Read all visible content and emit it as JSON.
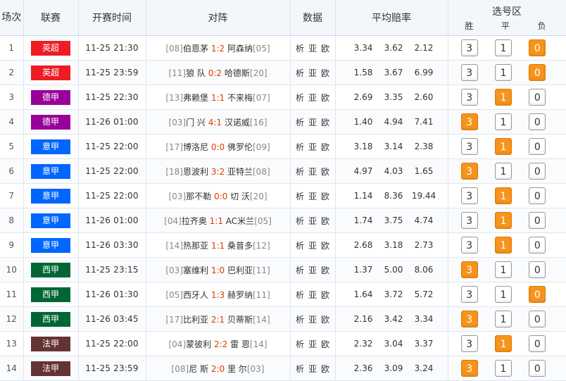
{
  "header": {
    "index": "场次",
    "league": "联赛",
    "time": "开赛时间",
    "match": "对阵",
    "data": "数据",
    "odds": "平均赔率",
    "select": "选号区",
    "win": "胜",
    "draw": "平",
    "lose": "负"
  },
  "colors": {
    "英超": "#ee1c24",
    "德甲": "#990099",
    "意甲": "#0066ff",
    "西甲": "#006633",
    "法甲": "#663333",
    "selected": "#f7941d"
  },
  "data_links": [
    "析",
    "亚",
    "欧"
  ],
  "rows": [
    {
      "no": "1",
      "league": "英超",
      "time": "11-25 21:30",
      "home_rank": "[08]",
      "home": "伯恩茅",
      "score": "1:2",
      "away": "阿森纳",
      "away_rank": "[05]",
      "odds": [
        "3.34",
        "3.62",
        "2.12"
      ],
      "pick": [
        "3",
        "1",
        "0"
      ],
      "selected": 2
    },
    {
      "no": "2",
      "league": "英超",
      "time": "11-25 23:59",
      "home_rank": "[11]",
      "home": "狼 队",
      "score": "0:2",
      "away": "哈德斯",
      "away_rank": "[20]",
      "odds": [
        "1.58",
        "3.67",
        "6.99"
      ],
      "pick": [
        "3",
        "1",
        "0"
      ],
      "selected": 2
    },
    {
      "no": "3",
      "league": "德甲",
      "time": "11-25 22:30",
      "home_rank": "[13]",
      "home": "弗赖堡",
      "score": "1:1",
      "away": "不来梅",
      "away_rank": "[07]",
      "odds": [
        "2.69",
        "3.35",
        "2.60"
      ],
      "pick": [
        "3",
        "1",
        "0"
      ],
      "selected": 1
    },
    {
      "no": "4",
      "league": "德甲",
      "time": "11-26 01:00",
      "home_rank": "[03]",
      "home": "门 兴",
      "score": "4:1",
      "away": "汉诺威",
      "away_rank": "[16]",
      "odds": [
        "1.40",
        "4.94",
        "7.41"
      ],
      "pick": [
        "3",
        "1",
        "0"
      ],
      "selected": 0
    },
    {
      "no": "5",
      "league": "意甲",
      "time": "11-25 22:00",
      "home_rank": "[17]",
      "home": "博洛尼",
      "score": "0:0",
      "away": "佛罗伦",
      "away_rank": "[09]",
      "odds": [
        "3.18",
        "3.14",
        "2.38"
      ],
      "pick": [
        "3",
        "1",
        "0"
      ],
      "selected": 1
    },
    {
      "no": "6",
      "league": "意甲",
      "time": "11-25 22:00",
      "home_rank": "[18]",
      "home": "恩波利",
      "score": "3:2",
      "away": "亚特兰",
      "away_rank": "[08]",
      "odds": [
        "4.97",
        "4.03",
        "1.65"
      ],
      "pick": [
        "3",
        "1",
        "0"
      ],
      "selected": 0
    },
    {
      "no": "7",
      "league": "意甲",
      "time": "11-25 22:00",
      "home_rank": "[03]",
      "home": "那不勒",
      "score": "0:0",
      "away": "切 沃",
      "away_rank": "[20]",
      "odds": [
        "1.14",
        "8.36",
        "19.44"
      ],
      "pick": [
        "3",
        "1",
        "0"
      ],
      "selected": 1
    },
    {
      "no": "8",
      "league": "意甲",
      "time": "11-26 01:00",
      "home_rank": "[04]",
      "home": "拉齐奥",
      "score": "1:1",
      "away": "AC米兰",
      "away_rank": "[05]",
      "odds": [
        "1.74",
        "3.75",
        "4.74"
      ],
      "pick": [
        "3",
        "1",
        "0"
      ],
      "selected": 1
    },
    {
      "no": "9",
      "league": "意甲",
      "time": "11-26 03:30",
      "home_rank": "[14]",
      "home": "热那亚",
      "score": "1:1",
      "away": "桑普多",
      "away_rank": "[12]",
      "odds": [
        "2.68",
        "3.18",
        "2.73"
      ],
      "pick": [
        "3",
        "1",
        "0"
      ],
      "selected": 1
    },
    {
      "no": "10",
      "league": "西甲",
      "time": "11-25 23:15",
      "home_rank": "[03]",
      "home": "塞维利",
      "score": "1:0",
      "away": "巴利亚",
      "away_rank": "[11]",
      "odds": [
        "1.37",
        "5.00",
        "8.06"
      ],
      "pick": [
        "3",
        "1",
        "0"
      ],
      "selected": 0
    },
    {
      "no": "11",
      "league": "西甲",
      "time": "11-26 01:30",
      "home_rank": "[05]",
      "home": "西牙人",
      "score": "1:3",
      "away": "赫罗纳",
      "away_rank": "[11]",
      "odds": [
        "1.64",
        "3.72",
        "5.72"
      ],
      "pick": [
        "3",
        "1",
        "0"
      ],
      "selected": 2
    },
    {
      "no": "12",
      "league": "西甲",
      "time": "11-26 03:45",
      "home_rank": "[17]",
      "home": "比利亚",
      "score": "2:1",
      "away": "贝蒂斯",
      "away_rank": "[14]",
      "odds": [
        "2.16",
        "3.42",
        "3.34"
      ],
      "pick": [
        "3",
        "1",
        "0"
      ],
      "selected": 0
    },
    {
      "no": "13",
      "league": "法甲",
      "time": "11-25 22:00",
      "home_rank": "[04]",
      "home": "蒙彼利",
      "score": "2:2",
      "away": "雷 恩",
      "away_rank": "[14]",
      "odds": [
        "2.32",
        "3.04",
        "3.37"
      ],
      "pick": [
        "3",
        "1",
        "0"
      ],
      "selected": 1
    },
    {
      "no": "14",
      "league": "法甲",
      "time": "11-25 23:59",
      "home_rank": "[08]",
      "home": "尼 斯",
      "score": "2:0",
      "away": "里 尔",
      "away_rank": "[03]",
      "odds": [
        "2.36",
        "3.09",
        "3.24"
      ],
      "pick": [
        "3",
        "1",
        "0"
      ],
      "selected": 0
    }
  ]
}
